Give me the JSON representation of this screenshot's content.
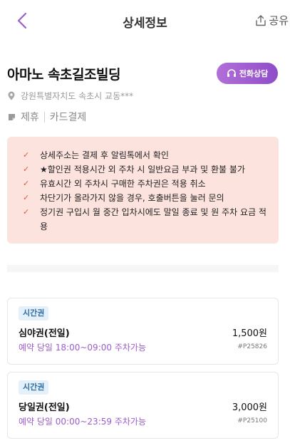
{
  "header": {
    "title": "상세정보",
    "share_label": "공유",
    "back_icon": "chevron-left-icon",
    "share_icon": "share-icon"
  },
  "place": {
    "name": "아마노 속초길조빌딩",
    "consult_label": "전화상담",
    "address": "강원특별자치도 속초시 교동***",
    "tags": [
      "제휴",
      "카드결제"
    ]
  },
  "notices": [
    "상세주소는 결제 후 알림톡에서 확인",
    "★할인권 적용시간 외 주차 시 일반요금 부과 및 환불 불가",
    "유효시간 외 주차시 구매한 주차권은 적용 취소",
    "차단기가 올라가지 않을 경우, 호출버튼을 눌러 문의",
    "정기권 구입시 월 중간 입차시에도 말일 종료 및 원 주차 요금 적용"
  ],
  "tickets": [
    {
      "badge": "시간권",
      "name": "심야권(전일)",
      "price": "1,500원",
      "time": "예약 당일 18:00~09:00 주차가능",
      "code": "#P25826"
    },
    {
      "badge": "시간권",
      "name": "당일권(전일)",
      "price": "3,000원",
      "time": "예약 당일 00:00~23:59 주차가능",
      "code": "#P25100"
    }
  ],
  "colors": {
    "accent_purple": "#9a5ec8",
    "notice_bg": "#fde3de",
    "check_red": "#e0574a",
    "badge_bg": "#e4f0fa"
  }
}
